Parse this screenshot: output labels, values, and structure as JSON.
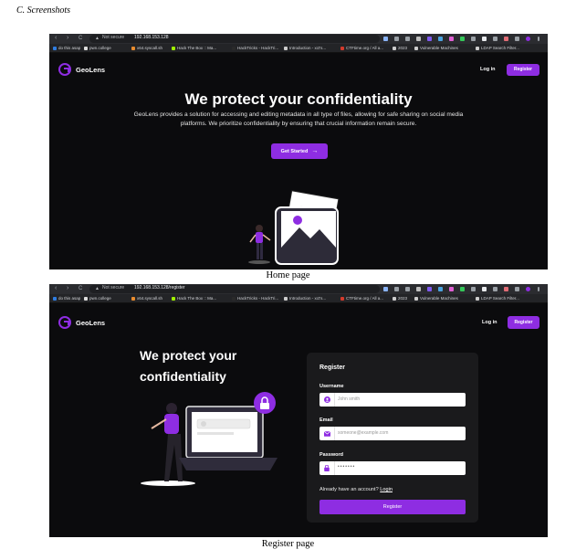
{
  "section_heading": "C.   Screenshots",
  "browser": {
    "nav_back": "‹",
    "nav_forward": "›",
    "reload": "C",
    "security_warning": "Not secure",
    "url_home": "192.168.153.128",
    "url_register": "192.168.153.128/register",
    "bookmarks": [
      {
        "label": "do this asap",
        "color": "#2f7de1"
      },
      {
        "label": "pwn.college",
        "color": "#dddddd"
      },
      {
        "label": "x64.syscall.sh",
        "color": "#e88b2e"
      },
      {
        "label": "Hack The Box :: Ma...",
        "color": "#9fef00"
      },
      {
        "label": "HackTricks - HackTri...",
        "color": "#2a2a2a"
      },
      {
        "label": "Introduction - xct's...",
        "color": "#cccccc"
      },
      {
        "label": "CTFtime.org / All a...",
        "color": "#d33a2c"
      },
      {
        "label": "2023",
        "color": "#cccccc"
      },
      {
        "label": "Vulnerable Machines",
        "color": "#cccccc"
      },
      {
        "label": "LDAP Search Filter...",
        "color": "#cccccc"
      }
    ]
  },
  "app": {
    "brand": "GeoLens",
    "login_label": "Log in",
    "register_label": "Register",
    "accent_color": "#8e2de2"
  },
  "home": {
    "title": "We protect your confidentiality",
    "subtitle": "GeoLens provides a solution for accessing and editing metadata in all type of files, allowing for safe sharing on social media platforms. We prioritize confidentiality by ensuring that crucial information remain secure.",
    "cta_label": "Get Started",
    "cta_icon": "→"
  },
  "register": {
    "title_line1": "We protect your",
    "title_line2": "confidentiality",
    "form_title": "Register",
    "username_label": "Username",
    "username_placeholder": "John smith",
    "email_label": "Email",
    "email_placeholder": "someone@example.com",
    "password_label": "Password",
    "password_value": "•••••••",
    "have_account": "Already have an account?",
    "login_link": "Login",
    "submit_label": "Register"
  },
  "captions": {
    "home": "Home page",
    "register": "Register page"
  }
}
